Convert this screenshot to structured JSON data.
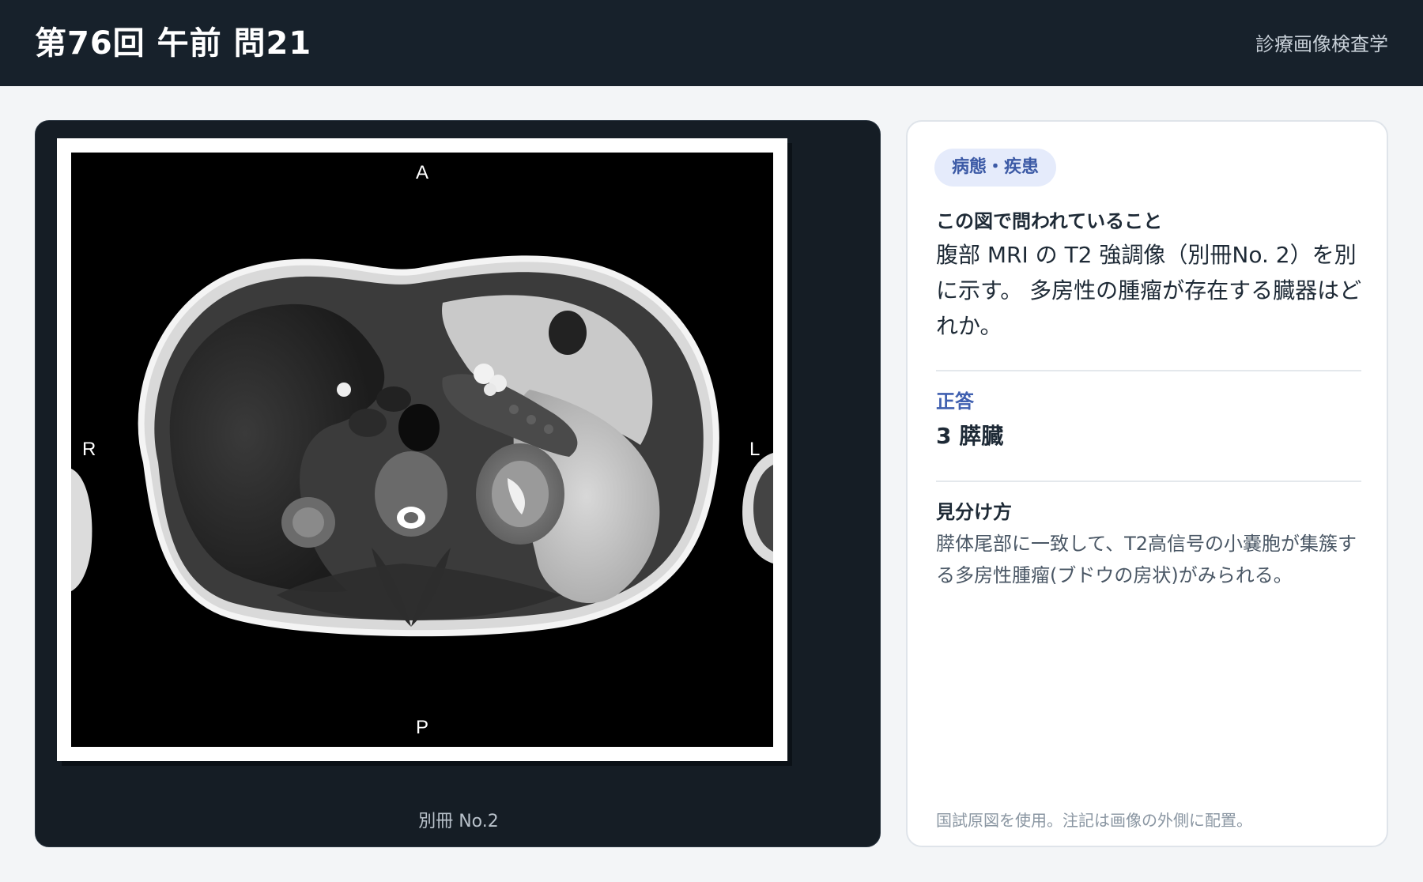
{
  "header": {
    "title": "第76回 午前 問21",
    "subject": "診療画像検査学"
  },
  "viewer": {
    "image_description_label": "腹部MRI T2強調像",
    "orientation": {
      "anterior": "A",
      "posterior": "P",
      "right": "R",
      "left": "L"
    },
    "caption": "別冊 No.2"
  },
  "panel": {
    "tag": "病態・疾患",
    "question_heading": "この図で問われていること",
    "question_text": "腹部 MRI の T2 強調像（別冊No. 2）を別に示す。 多房性の腫瘤が存在する臓器はどれか。",
    "answer_label": "正答",
    "answer_text": "3 膵臓",
    "tip_heading": "見分け方",
    "tip_text": "膵体尾部に一致して、T2高信号の小嚢胞が集簇する多房性腫瘤(ブドウの房状)がみられる。",
    "footnote": "国試原図を使用。注記は画像の外側に配置。"
  },
  "colors": {
    "header_bg": "#17212b",
    "viewer_bg": "#151d25",
    "tag_bg": "#e5ebfb",
    "tag_text": "#3c5aa6",
    "accent": "#4060b0"
  }
}
